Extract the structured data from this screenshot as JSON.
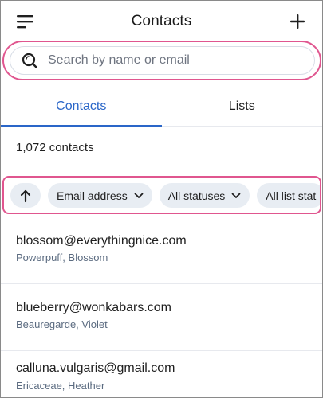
{
  "header": {
    "title": "Contacts",
    "menu_icon": "hamburger-menu-icon",
    "add_icon": "plus-icon"
  },
  "search": {
    "placeholder": "Search by name or email",
    "value": "",
    "icon": "search-icon"
  },
  "tabs": [
    {
      "label": "Contacts",
      "active": true
    },
    {
      "label": "Lists",
      "active": false
    }
  ],
  "contact_count": "1,072 contacts",
  "filters": {
    "sort_icon": "arrow-up-icon",
    "chips": [
      {
        "label": "Email address"
      },
      {
        "label": "All statuses"
      },
      {
        "label": "All list stat"
      }
    ]
  },
  "contacts": [
    {
      "email": "blossom@everythingnice.com",
      "name": "Powerpuff, Blossom"
    },
    {
      "email": "blueberry@wonkabars.com",
      "name": "Beauregarde, Violet"
    },
    {
      "email": "calluna.vulgaris@gmail.com",
      "name": "Ericaceae, Heather"
    }
  ],
  "colors": {
    "accent": "#2a66c8",
    "highlight": "#e0568f",
    "chip_bg": "#e8edf3",
    "secondary_text": "#5b6b80"
  }
}
